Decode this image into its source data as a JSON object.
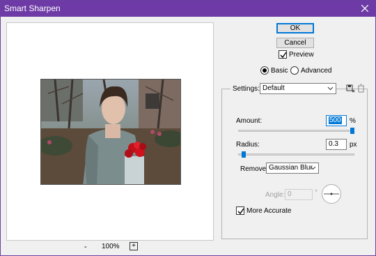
{
  "window": {
    "title": "Smart Sharpen"
  },
  "preview": {
    "zoom_minus": "-",
    "zoom_value": "100%",
    "zoom_plus": "+"
  },
  "buttons": {
    "ok": "OK",
    "cancel": "Cancel"
  },
  "preview_toggle": {
    "label": "Preview",
    "checked": true
  },
  "mode": {
    "options": [
      "Basic",
      "Advanced"
    ],
    "selected": "Basic"
  },
  "settings": {
    "label": "Settings:",
    "value": "Default"
  },
  "amount": {
    "label": "Amount:",
    "value": "500",
    "unit": "%",
    "slider_fraction": 1.0
  },
  "radius": {
    "label": "Radius:",
    "value": "0.3",
    "unit": "px",
    "slider_fraction": 0.03
  },
  "remove": {
    "label": "Remove:",
    "value": "Gaussian Blur"
  },
  "angle": {
    "label": "Angle:",
    "value": "0",
    "unit": "°"
  },
  "more_accurate": {
    "label": "More Accurate",
    "checked": true
  },
  "colors": {
    "titlebar": "#6d3aa6",
    "accent": "#0078d7"
  }
}
